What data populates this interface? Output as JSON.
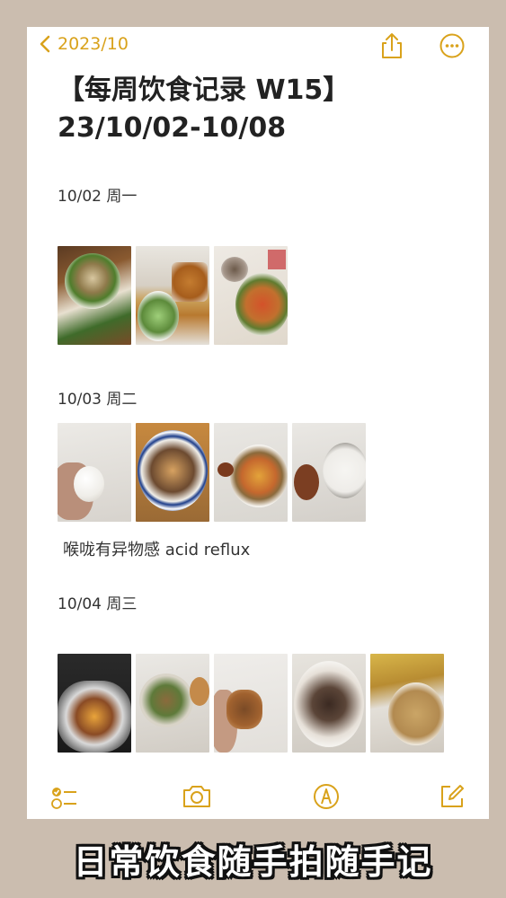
{
  "nav": {
    "back_label": "2023/10"
  },
  "note": {
    "title_line1": "【每周饮食记录 W15】",
    "title_line2": "23/10/02-10/08",
    "days": [
      {
        "label": "10/02 周一",
        "photos": [
          "food-photo",
          "food-photo",
          "food-photo"
        ]
      },
      {
        "label": "10/03 周二",
        "photos": [
          "food-photo",
          "food-photo",
          "food-photo",
          "food-photo"
        ],
        "comment": "喉咙有异物感 acid reflux"
      },
      {
        "label": "10/04 周三",
        "photos": [
          "food-photo",
          "food-photo",
          "food-photo",
          "food-photo",
          "food-photo"
        ]
      }
    ]
  },
  "toolbar": {
    "icons": [
      "checklist-icon",
      "camera-icon",
      "markup-pen-icon",
      "compose-icon"
    ]
  },
  "banner": {
    "text": "日常饮食随手拍随手记"
  },
  "colors": {
    "accent": "#d9a21b",
    "background": "#cbbdaf"
  }
}
